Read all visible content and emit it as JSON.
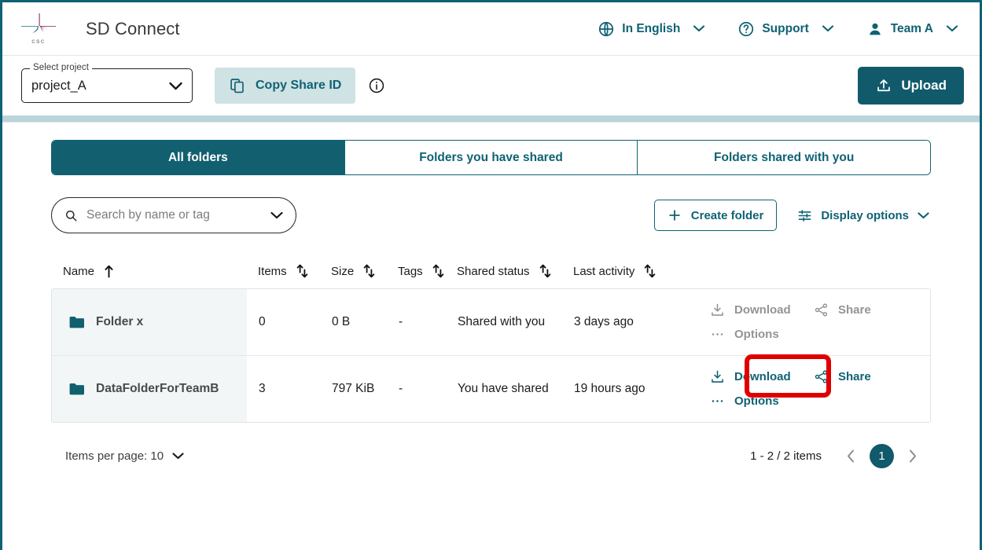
{
  "header": {
    "logo_text": "csc",
    "title": "SD Connect",
    "items": [
      {
        "icon": "globe-icon",
        "label": "In English",
        "chevron": "chevron-down-icon"
      },
      {
        "icon": "question-circle-icon",
        "label": "Support",
        "chevron": "chevron-down-icon"
      },
      {
        "icon": "person-icon",
        "label": "Team A",
        "chevron": "chevron-down-icon"
      }
    ]
  },
  "toolbar": {
    "select_legend": "Select project",
    "select_value": "project_A",
    "select_chevron": "chevron-down-icon",
    "copy_share_id_label": "Copy Share ID",
    "copy_icon": "copy-icon",
    "info_icon": "info-circle-icon",
    "upload_label": "Upload",
    "upload_icon": "upload-icon"
  },
  "tabs": [
    {
      "label": "All folders",
      "active": true
    },
    {
      "label": "Folders you have shared",
      "active": false
    },
    {
      "label": "Folders shared with you",
      "active": false
    }
  ],
  "search": {
    "placeholder": "Search by name or tag",
    "value": "",
    "search_icon": "search-icon",
    "chevron": "chevron-down-icon"
  },
  "actions": {
    "create_folder_label": "Create folder",
    "create_folder_icon": "plus-icon",
    "display_options_label": "Display options",
    "display_options_icon": "tune-sliders-icon",
    "display_options_chevron": "chevron-down-icon"
  },
  "table": {
    "columns": [
      {
        "label": "Name",
        "sort": "asc"
      },
      {
        "label": "Items",
        "sort": "none"
      },
      {
        "label": "Size",
        "sort": "none"
      },
      {
        "label": "Tags",
        "sort": "none"
      },
      {
        "label": "Shared status",
        "sort": "none"
      },
      {
        "label": "Last activity",
        "sort": "none"
      }
    ],
    "rows": [
      {
        "folder_icon": "folder-icon",
        "name": "Folder x",
        "items": "0",
        "size": "0 B",
        "tags": "-",
        "shared_status": "Shared with you",
        "last_activity": "3 days ago",
        "download_label": "Download",
        "share_label": "Share",
        "options_label": "Options",
        "actions_enabled": false,
        "highlight_share": false
      },
      {
        "folder_icon": "folder-icon",
        "name": "DataFolderForTeamB",
        "items": "3",
        "size": "797 KiB",
        "tags": "-",
        "shared_status": "You have shared",
        "last_activity": "19 hours ago",
        "download_label": "Download",
        "share_label": "Share",
        "options_label": "Options",
        "actions_enabled": true,
        "highlight_share": true
      }
    ]
  },
  "footer": {
    "items_per_page_label": "Items per page: 10",
    "items_per_page_chevron": "chevron-down-icon",
    "range_label": "1 - 2 / 2 items",
    "prev_icon": "chevron-left-icon",
    "next_icon": "chevron-right-icon",
    "current_page": "1"
  },
  "colors": {
    "brand_teal": "#0f6274",
    "deep_teal": "#115a6b",
    "tab_active": "#125f70",
    "chip_bg": "#cfe2e4",
    "separator": "#b9d4da",
    "name_cell_bg": "#f2f6f6",
    "disabled_text": "#949494",
    "highlight_red": "#e00000",
    "logo_teal": "#1d7286",
    "logo_maroon": "#7b2150"
  }
}
